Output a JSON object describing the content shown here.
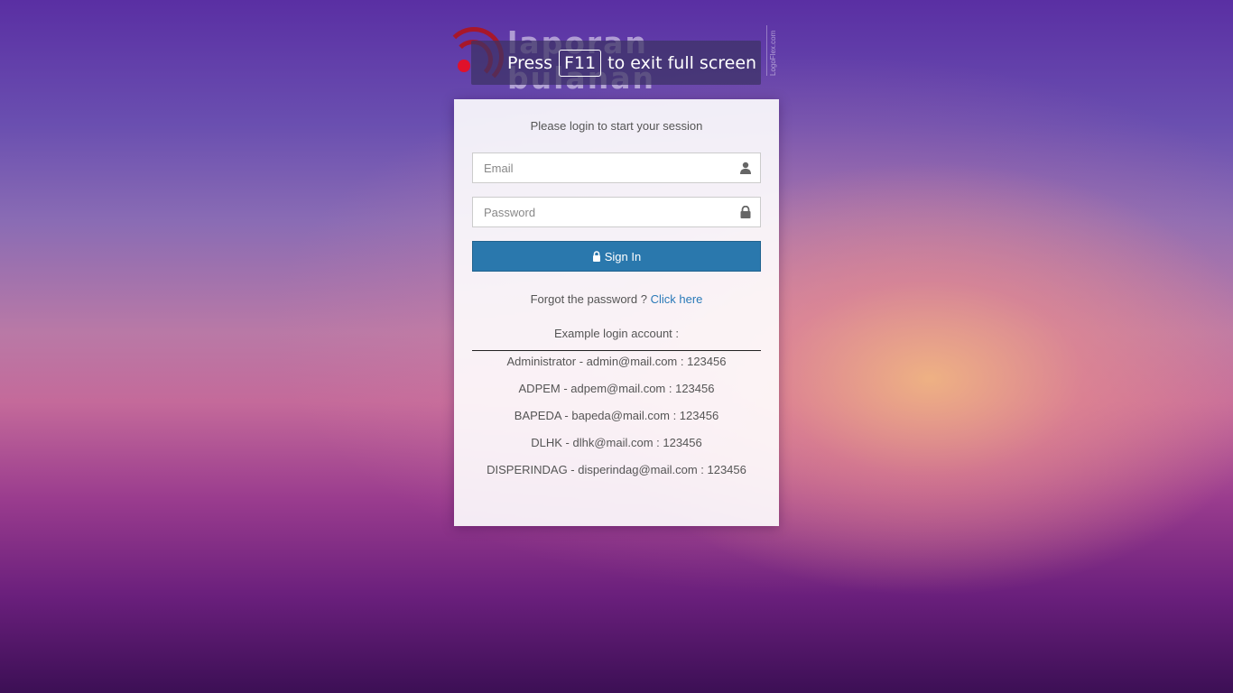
{
  "logo": {
    "brand_text": "laporan bulanan",
    "side_text": "LogoFlex.com"
  },
  "fullscreen_notice": {
    "prefix": "Press",
    "key": "F11",
    "suffix": "to exit full screen"
  },
  "login": {
    "message": "Please login to start your session",
    "email_placeholder": "Email",
    "password_placeholder": "Password",
    "sign_in_label": "Sign In",
    "forgot_text": "Forgot the password ?",
    "forgot_link": "Click here",
    "example_title": "Example login account :",
    "accounts": [
      "Administrator - admin@mail.com : 123456",
      "ADPEM - adpem@mail.com : 123456",
      "BAPEDA - bapeda@mail.com : 123456",
      "DLHK - dlhk@mail.com : 123456",
      "DISPERINDAG - disperindag@mail.com : 123456"
    ]
  },
  "icons": {
    "email": "user-icon",
    "password": "lock-icon",
    "button": "lock-icon"
  },
  "colors": {
    "primary_button": "#2a78ad",
    "link": "#2a7ab8",
    "logo_red": "#e0112b"
  }
}
